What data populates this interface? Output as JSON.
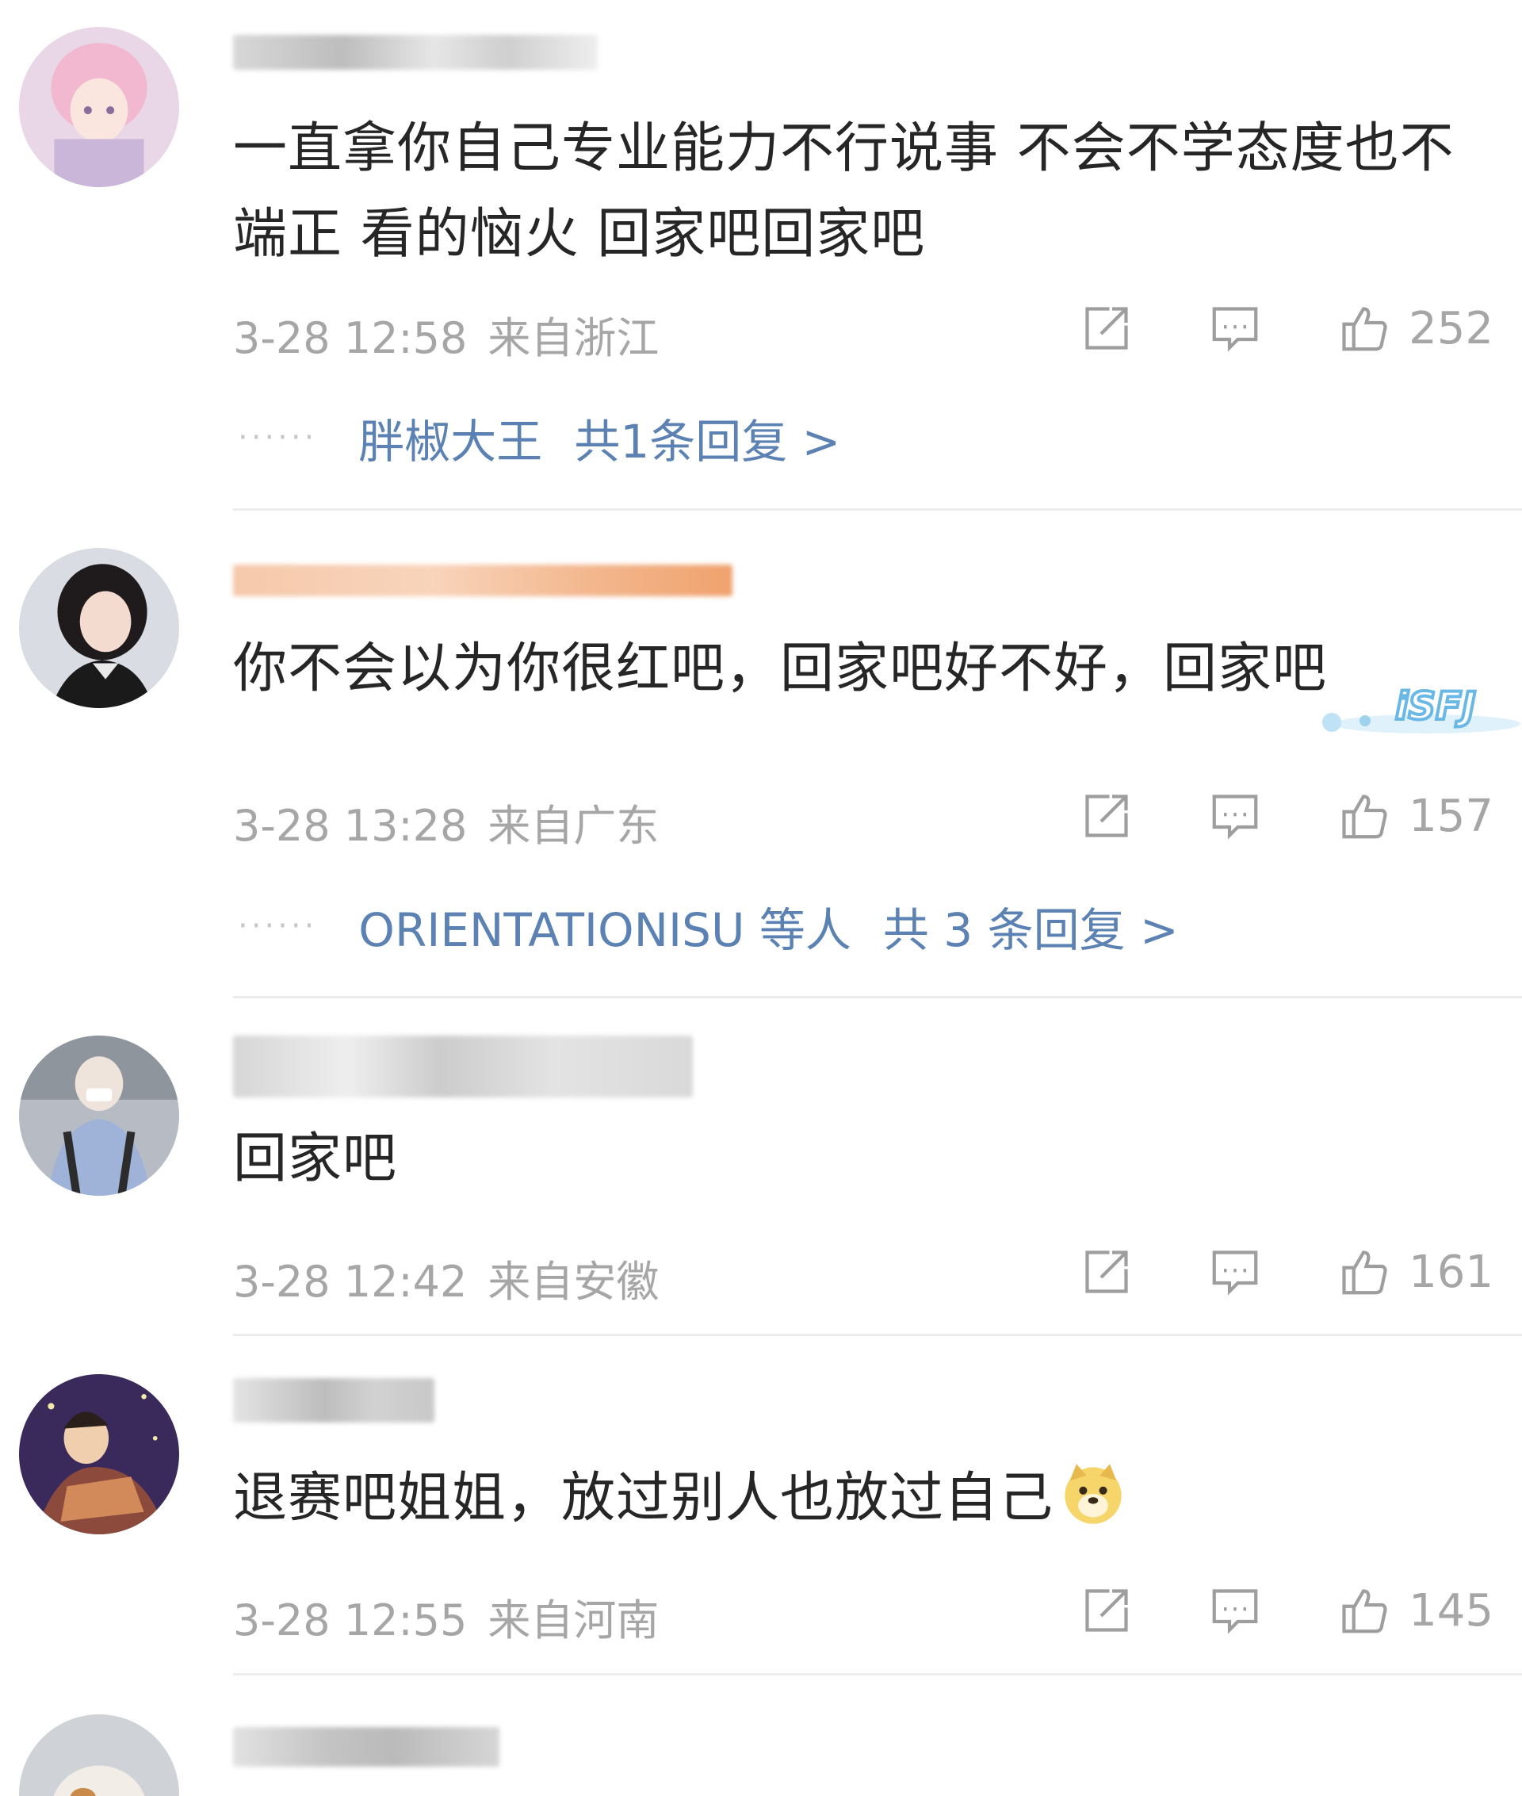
{
  "comments": [
    {
      "text": "一直拿你自己专业能力不行说事 不会不学态度也不端正 看的恼火 回家吧回家吧",
      "date": "3-28 12:58",
      "location": "来自浙江",
      "likes": "252",
      "replies": {
        "name": "胖椒大王",
        "count_label": "共1条回复 >"
      }
    },
    {
      "text": "你不会以为你很红吧，回家吧好不好，回家吧",
      "date": "3-28 13:28",
      "location": "来自广东",
      "likes": "157",
      "replies": {
        "name": "ORIENTATIONISU 等人",
        "count_label": "共 3 条回复 >"
      },
      "sticker_text": "iSFJ"
    },
    {
      "text": "回家吧",
      "date": "3-28 12:42",
      "location": "来自安徽",
      "likes": "161"
    },
    {
      "text": "退赛吧姐姐，放过别人也放过自己",
      "date": "3-28 12:55",
      "location": "来自河南",
      "likes": "145",
      "emoji": "doge-emoji"
    }
  ],
  "icons": {
    "share": "share-icon",
    "comment": "comment-icon",
    "like": "thumbs-up-icon"
  },
  "colors": {
    "reply_link": "#5b82b3",
    "meta": "#a6a6a6",
    "text": "#262626"
  }
}
